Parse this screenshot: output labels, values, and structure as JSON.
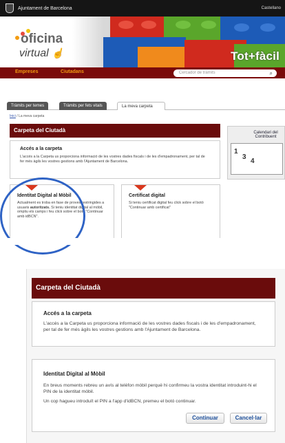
{
  "topbar": {
    "org": "Ajuntament de Barcelona",
    "right": "Castellano"
  },
  "banner": {
    "logo_main": "oficina",
    "logo_sub": "virtual",
    "tagline": "Tot+fàcil",
    "colors": {
      "lego_red": "#d02a1e",
      "lego_green": "#5aa62b",
      "lego_blue": "#1d5bb7",
      "lego_orange": "#f08a1c"
    }
  },
  "nav": {
    "items": [
      "Empreses",
      "Ciutadans"
    ],
    "search_placeholder": "Cercador de tràmits",
    "search_icon": "search-icon"
  },
  "tabs": [
    "Tràmits per temes",
    "Tràmits per fets vitals",
    "La meva carpeta"
  ],
  "breadcrumb": {
    "home": "Inici",
    "sep": " / ",
    "current": "La meva carpeta"
  },
  "panel_small": {
    "heading": "Carpeta del Ciutadà",
    "access_title": "Accés a la carpeta",
    "access_text": "L'accés a la Carpeta us proporciona informació de les vostres dades fiscals i de les d'empadronament, per tal de fer més àgils les vostres gestions amb l'Ajuntament de Barcelona.",
    "idm_title": "Identitat Digital al Mòbil",
    "idm_text_a": "Actualment es troba en fase de proves restringides a usuaris ",
    "idm_text_bold": "autoritzats.",
    "idm_text_b": " Si teniu identitat digital al mòbil, ompliu els camps i feu click sobre el botó \"Continuar amb idBCN\".",
    "cert_title": "Certificat digital",
    "cert_text": "Si teniu certificat digital feu click sobre el botó \"Continuar amb certificat\"",
    "calendar_title": "Calendari del Contribuent",
    "calendar_numbers": [
      "1",
      "3",
      "4"
    ]
  },
  "panel_large": {
    "heading": "Carpeta del Ciutadà",
    "access_title": "Accés a la carpeta",
    "access_text": "L'accés a la Carpeta us proporciona informació de les vostres dades fiscals i de les d'empadronament, per tal de fer més àgils les vostres gestions amb l'Ajuntament de Barcelona.",
    "idm_title": "Identitat Digital al Mòbil",
    "idm_text_1": "En breus moments rebreu un avís al telèfon mòbil perquè hi confirmeu la vostra identitat introduint-hi el PIN de la identitat mòbil.",
    "idm_text_2": "Un cop hagueu introduït el PIN a l'app d'idBCN, premeu el botó continuar.",
    "continue_label": "Continuar",
    "cancel_label": "Cancel·lar"
  }
}
